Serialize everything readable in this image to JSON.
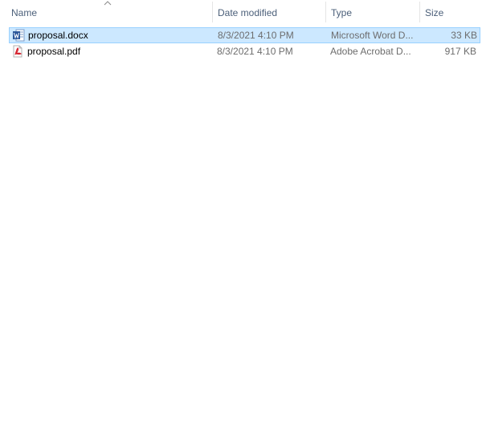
{
  "columns": {
    "name": "Name",
    "date": "Date modified",
    "type": "Type",
    "size": "Size"
  },
  "sort": {
    "column": "Name",
    "icon": "chevron-up-icon"
  },
  "files": [
    {
      "name": "proposal.docx",
      "date": "8/3/2021 4:10 PM",
      "type": "Microsoft Word D...",
      "size": "33 KB",
      "icon": "word-document-icon",
      "selected": true
    },
    {
      "name": "proposal.pdf",
      "date": "8/3/2021 4:10 PM",
      "type": "Adobe Acrobat D...",
      "size": "917 KB",
      "icon": "pdf-document-icon",
      "selected": false
    }
  ],
  "colors": {
    "selection_fill": "#cce8ff",
    "selection_border": "#99d1ff",
    "header_text": "#4c607a",
    "secondary_text": "#6d6d6d",
    "word_blue": "#2b579a",
    "pdf_red": "#d4202c"
  }
}
